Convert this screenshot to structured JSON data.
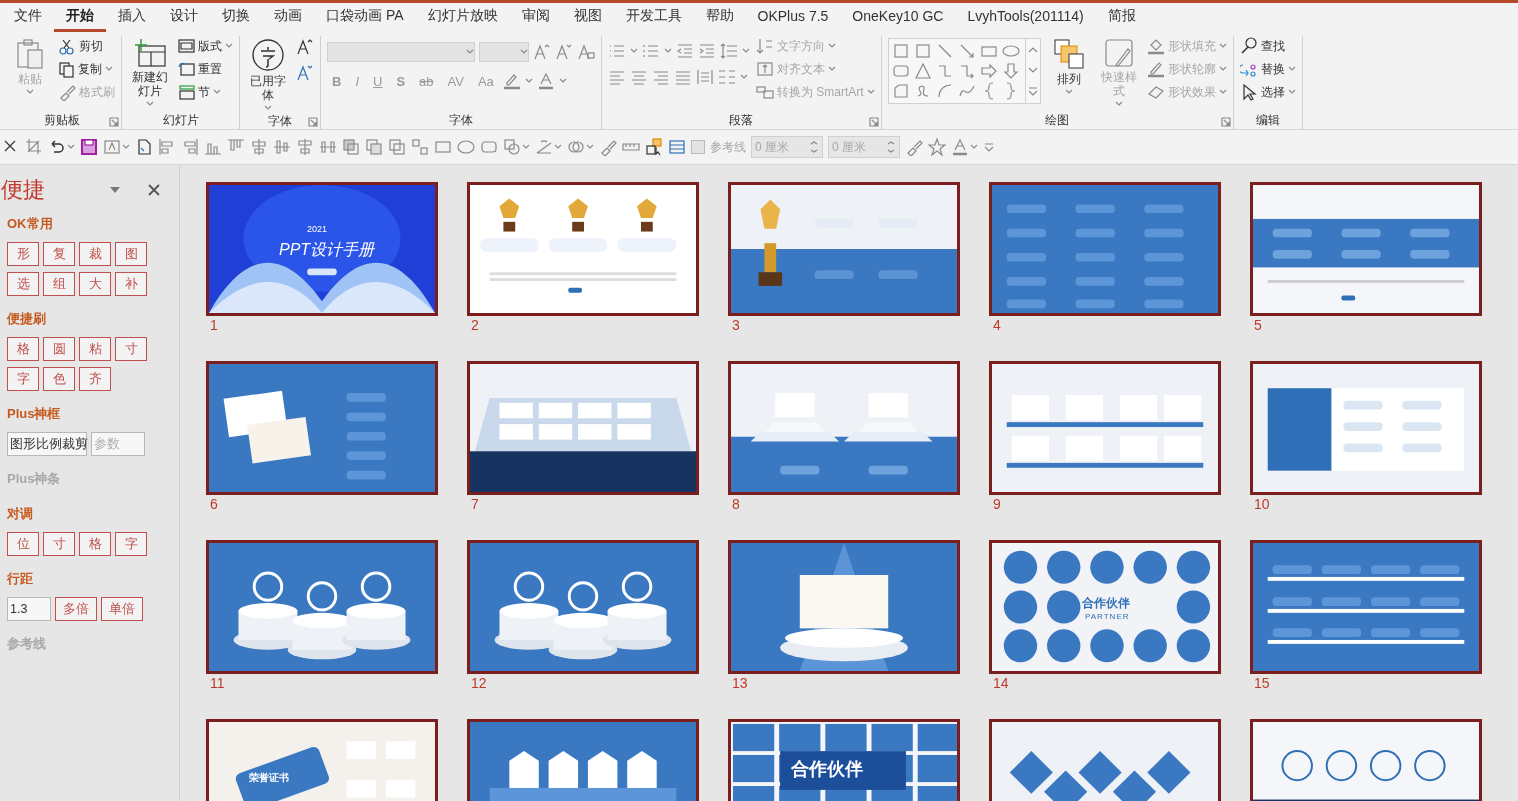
{
  "tabs": [
    {
      "label": "文件",
      "selected": false
    },
    {
      "label": "开始",
      "selected": true
    },
    {
      "label": "插入",
      "selected": false
    },
    {
      "label": "设计",
      "selected": false
    },
    {
      "label": "切换",
      "selected": false
    },
    {
      "label": "动画",
      "selected": false
    },
    {
      "label": "口袋动画 PA",
      "selected": false
    },
    {
      "label": "幻灯片放映",
      "selected": false
    },
    {
      "label": "审阅",
      "selected": false
    },
    {
      "label": "视图",
      "selected": false
    },
    {
      "label": "开发工具",
      "selected": false
    },
    {
      "label": "帮助",
      "selected": false
    },
    {
      "label": "OKPlus 7.5",
      "selected": false
    },
    {
      "label": "OneKey10 GC",
      "selected": false
    },
    {
      "label": "LvyhTools(201114)",
      "selected": false
    },
    {
      "label": "简报",
      "selected": false
    }
  ],
  "ribbon_groups": [
    {
      "label": "剪贴板",
      "launcher": true,
      "items": [
        {
          "kind": "large",
          "label": "粘贴",
          "disabled": true,
          "dropdown": true
        },
        {
          "kind": "small",
          "label": "剪切",
          "disabled": false,
          "dropdown": false
        },
        {
          "kind": "small",
          "label": "复制",
          "disabled": false,
          "dropdown": true
        },
        {
          "kind": "small",
          "label": "格式刷",
          "disabled": true,
          "dropdown": false
        }
      ]
    },
    {
      "label": "幻灯片",
      "launcher": false,
      "items": [
        {
          "kind": "large",
          "label": "新建幻灯片",
          "disabled": false,
          "dropdown": true
        },
        {
          "kind": "small",
          "label": "版式",
          "disabled": false,
          "dropdown": true
        },
        {
          "kind": "small",
          "label": "重置",
          "disabled": false,
          "dropdown": false
        },
        {
          "kind": "small",
          "label": "节",
          "disabled": false,
          "dropdown": true
        }
      ]
    },
    {
      "label": "字体",
      "launcher": true,
      "items": [
        {
          "kind": "large",
          "label": "已用字体",
          "disabled": false,
          "dropdown": true
        },
        {
          "kind": "fontsize"
        }
      ]
    },
    {
      "label": "字体",
      "launcher": false,
      "items": [
        {
          "kind": "font",
          "formats": [
            "B",
            "I",
            "U",
            "S",
            "ab",
            "AV",
            "Aa"
          ]
        }
      ]
    },
    {
      "label": "段落",
      "launcher": true,
      "items": [
        {
          "kind": "paragraph"
        },
        {
          "kind": "small",
          "label": "文字方向",
          "disabled": true,
          "dropdown": true
        },
        {
          "kind": "small",
          "label": "对齐文本",
          "disabled": true,
          "dropdown": true
        },
        {
          "kind": "small",
          "label": "转换为 SmartArt",
          "disabled": true,
          "dropdown": true
        }
      ]
    },
    {
      "label": "绘图",
      "launcher": true,
      "items": [
        {
          "kind": "gallery"
        },
        {
          "kind": "large",
          "label": "排列",
          "disabled": false,
          "dropdown": true
        },
        {
          "kind": "large",
          "label": "快速样式",
          "disabled": true,
          "dropdown": true
        },
        {
          "kind": "small",
          "label": "形状填充",
          "disabled": true,
          "dropdown": true
        },
        {
          "kind": "small",
          "label": "形状轮廓",
          "disabled": true,
          "dropdown": true
        },
        {
          "kind": "small",
          "label": "形状效果",
          "disabled": true,
          "dropdown": true
        }
      ]
    },
    {
      "label": "编辑",
      "launcher": false,
      "items": [
        {
          "kind": "small",
          "label": "查找",
          "disabled": false,
          "dropdown": false
        },
        {
          "kind": "small",
          "label": "替换",
          "disabled": false,
          "dropdown": true
        },
        {
          "kind": "small",
          "label": "选择",
          "disabled": false,
          "dropdown": true
        }
      ]
    }
  ],
  "toolbar": {
    "guides": {
      "label": "参考线",
      "checked": false
    },
    "fields": [
      {
        "value": "0 厘米",
        "disabled": true
      },
      {
        "value": "0 厘米",
        "disabled": true
      }
    ]
  },
  "pane": {
    "title": "便捷",
    "sections": [
      {
        "heading": "OK常用",
        "enabled": true,
        "rows": [
          {
            "kind": "buttons",
            "buttons": [
              "形",
              "复",
              "裁",
              "图"
            ]
          },
          {
            "kind": "buttons",
            "buttons": [
              "选",
              "组",
              "大",
              "补"
            ]
          }
        ]
      },
      {
        "heading": "便捷刷",
        "enabled": true,
        "rows": [
          {
            "kind": "buttons",
            "buttons": [
              "格",
              "圆",
              "粘",
              "寸"
            ]
          },
          {
            "kind": "buttons",
            "buttons": [
              "字",
              "色",
              "齐"
            ]
          }
        ]
      },
      {
        "heading": "Plus神框",
        "enabled": true,
        "rows": [
          {
            "kind": "fields",
            "fields": [
              {
                "value": "图形比例裁剪"
              },
              {
                "placeholder": "参数"
              }
            ]
          }
        ]
      },
      {
        "heading": "Plus神条",
        "enabled": false
      },
      {
        "heading": "对调",
        "enabled": true,
        "rows": [
          {
            "kind": "buttons",
            "buttons": [
              "位",
              "寸",
              "格",
              "字"
            ]
          }
        ]
      },
      {
        "heading": "行距",
        "enabled": true,
        "rows": [
          {
            "kind": "field-buttons",
            "field": {
              "value": "1.3"
            },
            "buttons": [
              "多倍",
              "单倍"
            ]
          }
        ]
      },
      {
        "heading": "参考线",
        "enabled": false
      }
    ]
  },
  "slides": [
    {
      "number": "1",
      "kind": "cover",
      "texts": [
        "2021",
        "PPT设计手册"
      ]
    },
    {
      "number": "2",
      "kind": "trophy-white"
    },
    {
      "number": "3",
      "kind": "trophy-split"
    },
    {
      "number": "4",
      "kind": "grid-blue"
    },
    {
      "number": "5",
      "kind": "band-white"
    },
    {
      "number": "6",
      "kind": "certs-blue"
    },
    {
      "number": "7",
      "kind": "certs-box"
    },
    {
      "number": "8",
      "kind": "podium-split"
    },
    {
      "number": "9",
      "kind": "shelves-white"
    },
    {
      "number": "10",
      "kind": "panel-white"
    },
    {
      "number": "11",
      "kind": "podium-blue"
    },
    {
      "number": "12",
      "kind": "podium-blue"
    },
    {
      "number": "13",
      "kind": "stage-blue"
    },
    {
      "number": "14",
      "kind": "circles-white",
      "texts": [
        "合作伙伴",
        "PARTNER"
      ]
    },
    {
      "number": "15",
      "kind": "shelves-blue"
    },
    {
      "kind": "card-white",
      "texts": [
        "荣誉证书"
      ]
    },
    {
      "kind": "houses-blue"
    },
    {
      "kind": "tiles-blue",
      "texts": [
        "合作伙伴"
      ]
    },
    {
      "kind": "diamonds-white"
    },
    {
      "kind": "badges-white"
    }
  ]
}
